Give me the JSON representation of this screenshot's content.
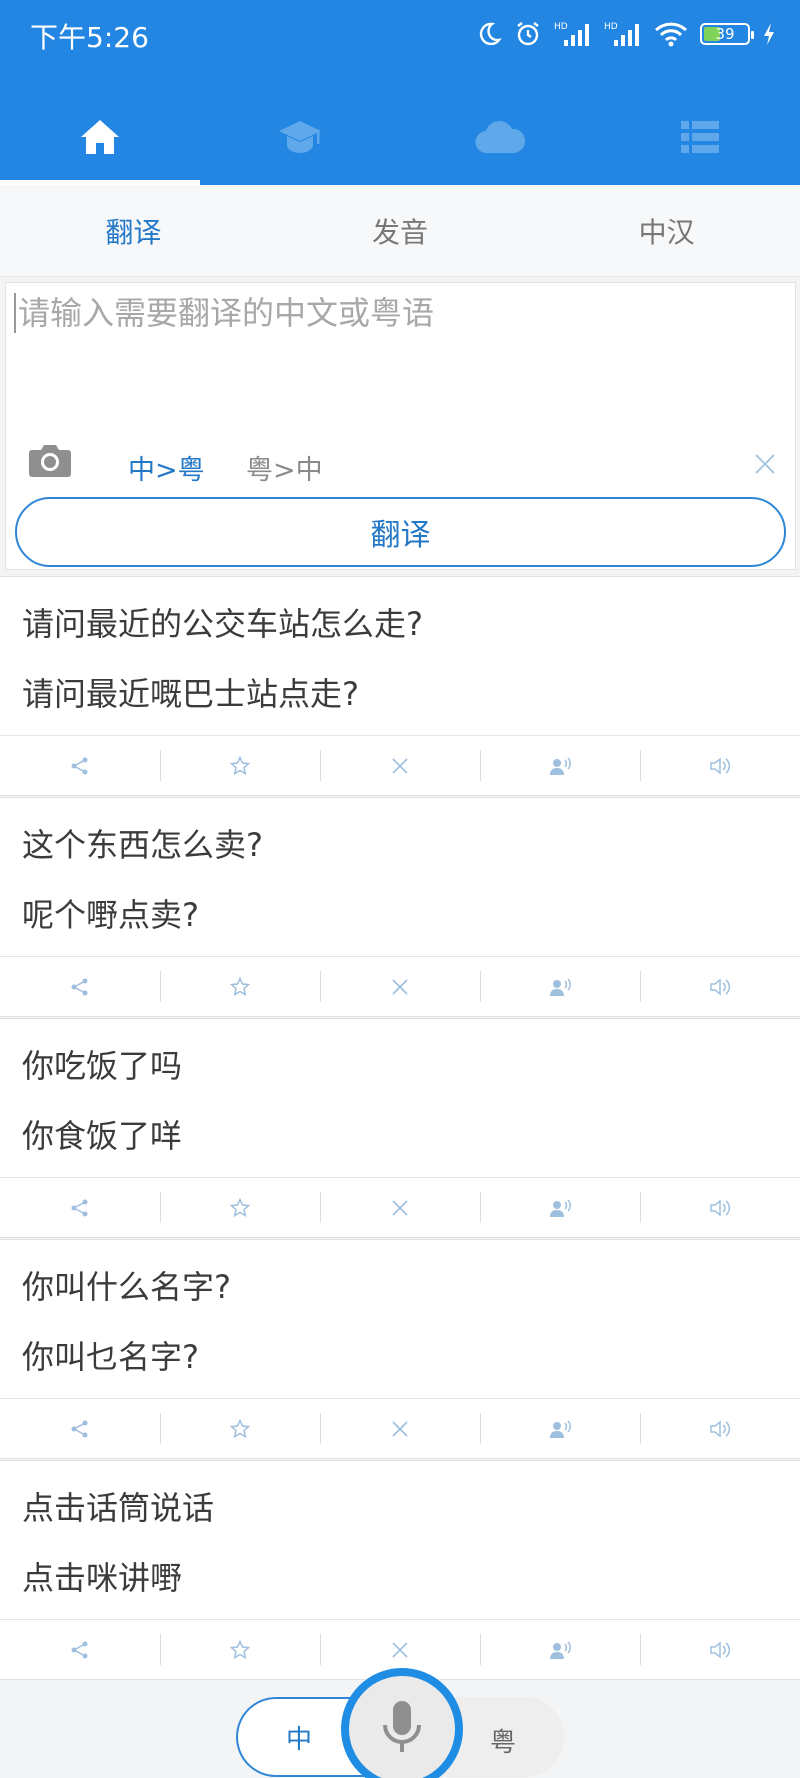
{
  "status": {
    "time": "下午5:26",
    "battery": "39",
    "network_badge": "HD"
  },
  "nav": {
    "tabs": [
      {
        "icon": "home-icon",
        "active": true
      },
      {
        "icon": "graduation-cap-icon",
        "active": false
      },
      {
        "icon": "cloud-icon",
        "active": false
      },
      {
        "icon": "list-icon",
        "active": false
      }
    ]
  },
  "subtabs": [
    {
      "label": "翻译",
      "active": true
    },
    {
      "label": "发音",
      "active": false
    },
    {
      "label": "中汉",
      "active": false
    }
  ],
  "input": {
    "placeholder": "请输入需要翻译的中文或粤语",
    "direction_zh_yue": "中>粤",
    "direction_yue_zh": "粤>中",
    "translate_label": "翻译"
  },
  "phrases": [
    {
      "zh": "请问最近的公交车站怎么走?",
      "yue": "请问最近嘅巴士站点走?"
    },
    {
      "zh": "这个东西怎么卖?",
      "yue": "呢个嘢点卖?"
    },
    {
      "zh": "你吃饭了吗",
      "yue": "你食饭了咩"
    },
    {
      "zh": "你叫什么名字?",
      "yue": "你叫乜名字?"
    },
    {
      "zh": "点击话筒说话",
      "yue": "点击咪讲嘢"
    }
  ],
  "voice": {
    "zh_label": "中",
    "yue_label": "粤"
  },
  "colors": {
    "primary": "#2286e2",
    "accent": "#2378c7",
    "icon_muted": "#9fbfdf"
  }
}
